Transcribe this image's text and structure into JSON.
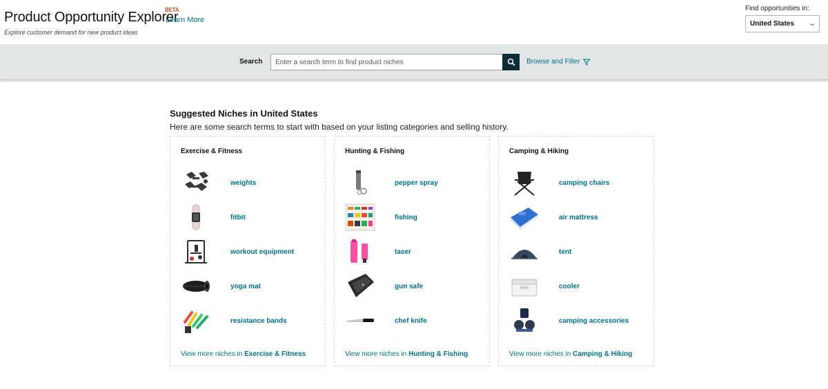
{
  "header": {
    "title": "Product Opportunity Explorer",
    "beta": "BETA",
    "learn_more": "Learn More",
    "subtitle": "Explore customer demand for new product ideas",
    "region_label": "Find opportunities in:",
    "region_value": "United States"
  },
  "search": {
    "label": "Search",
    "placeholder": "Enter a search term to find product niches",
    "browse_label": "Browse and Filter"
  },
  "main": {
    "heading": "Suggested Niches in United States",
    "subheading": "Here are some search terms to start with based on your listing categories and selling history."
  },
  "categories": [
    {
      "title": "Exercise & Fitness",
      "items": [
        {
          "label": "weights",
          "icon": "dumbbells-icon"
        },
        {
          "label": "fitbit",
          "icon": "fitness-tracker-icon"
        },
        {
          "label": "workout equipment",
          "icon": "home-gym-icon"
        },
        {
          "label": "yoga mat",
          "icon": "yoga-mat-icon"
        },
        {
          "label": "resistance bands",
          "icon": "resistance-bands-icon"
        }
      ],
      "view_more_prefix": "View more niches in ",
      "view_more_name": "Exercise & Fitness"
    },
    {
      "title": "Hunting & Fishing",
      "items": [
        {
          "label": "pepper spray",
          "icon": "pepper-spray-icon"
        },
        {
          "label": "fishing",
          "icon": "fishing-lures-icon"
        },
        {
          "label": "taser",
          "icon": "taser-icon"
        },
        {
          "label": "gun safe",
          "icon": "gun-safe-icon"
        },
        {
          "label": "chef knife",
          "icon": "chef-knife-icon"
        }
      ],
      "view_more_prefix": "View more niches in ",
      "view_more_name": "Hunting & Fishing"
    },
    {
      "title": "Camping & Hiking",
      "items": [
        {
          "label": "camping chairs",
          "icon": "camping-chair-icon"
        },
        {
          "label": "air mattress",
          "icon": "air-mattress-icon"
        },
        {
          "label": "tent",
          "icon": "tent-icon"
        },
        {
          "label": "cooler",
          "icon": "cooler-icon"
        },
        {
          "label": "camping accessories",
          "icon": "camping-accessories-icon"
        }
      ],
      "view_more_prefix": "View more niches in ",
      "view_more_name": "Camping & Hiking"
    }
  ],
  "colors": {
    "link": "#007185",
    "search_button": "#0b2d36",
    "search_band": "#e3e6e6",
    "beta": "#c7511f"
  }
}
